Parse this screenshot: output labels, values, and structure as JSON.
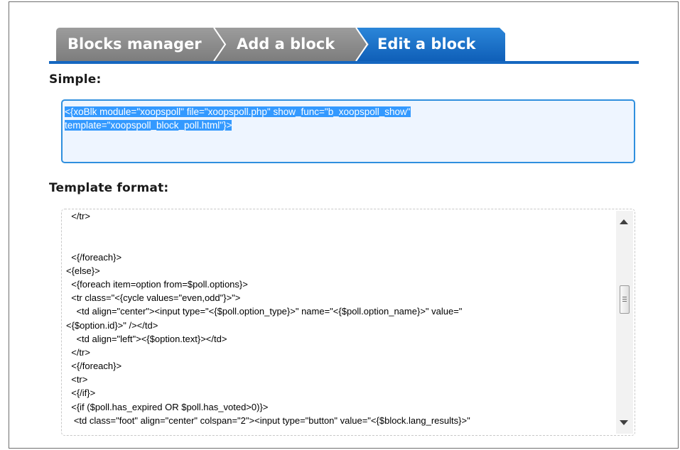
{
  "tabs": [
    {
      "label": "Blocks manager",
      "active": false
    },
    {
      "label": "Add a block",
      "active": false
    },
    {
      "label": "Edit a block",
      "active": true
    }
  ],
  "colors": {
    "active_tab": "#1567c0",
    "inactive_tab": "#8a8a8a",
    "selection": "#3399ff",
    "field_border": "#2f8fde",
    "spellcheck": "#ff3b3b"
  },
  "simple": {
    "label": "Simple:",
    "value_line1": "<{xoBlk module=\"xoopspoll\" file=\"xoopspoll.php\" show_func=\"b_xoopspoll_show\"",
    "value_line2": "template=\"xoopspoll_block_poll.html\"}>"
  },
  "template": {
    "label": "Template format:",
    "lines": [
      "  </tr>",
      "",
      "",
      "  <{/foreach}>",
      "<{else}>",
      "  <{foreach item=option from=$poll.options}>",
      "  <tr class=\"<{cycle values=\"even,odd\"}>\">",
      "    <td align=\"center\"><input type=\"<{$poll.option_type}>\" name=\"<{$poll.option_name}>\" value=\"",
      "<{$option.id}>\" /></td>",
      "    <td align=\"left\"><{$option.text}></td>",
      "  </tr>",
      "  <{/foreach}>",
      "  <tr>",
      "  <{/if}>",
      "  <{if ($poll.has_expired OR $poll.has_voted>0)}>",
      "   <td class=\"foot\" align=\"center\" colspan=\"2\"><input type=\"button\" value=\"<{$block.lang_results}>\""
    ]
  },
  "scrollbar": {
    "up_icon": "arrow-up-icon",
    "down_icon": "arrow-down-icon",
    "position": 0.35
  }
}
